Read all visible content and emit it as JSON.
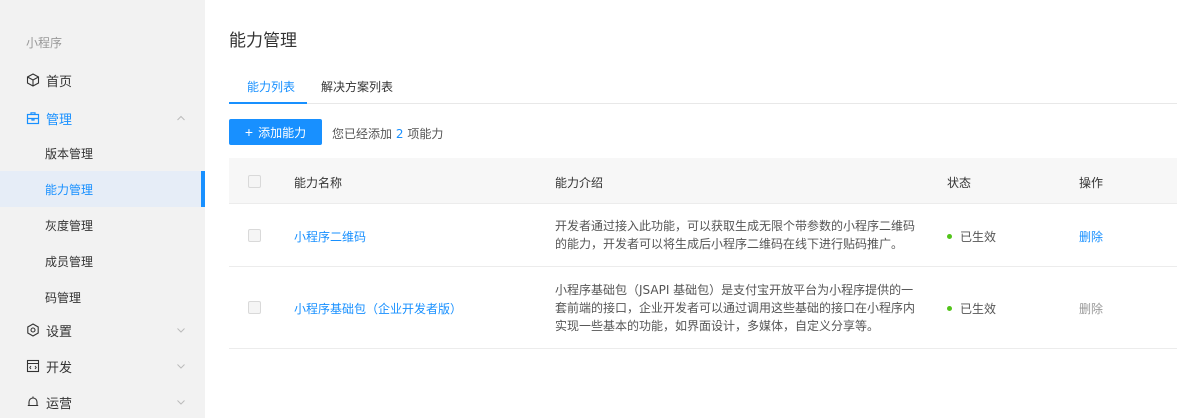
{
  "sidebar": {
    "section_title": "小程序",
    "items": [
      {
        "label": "首页"
      },
      {
        "label": "管理",
        "sub": [
          "版本管理",
          "能力管理",
          "灰度管理",
          "成员管理",
          "码管理"
        ]
      },
      {
        "label": "设置"
      },
      {
        "label": "开发"
      },
      {
        "label": "运营"
      }
    ]
  },
  "main": {
    "title": "能力管理",
    "tabs": [
      {
        "label": "能力列表"
      },
      {
        "label": "解决方案列表"
      }
    ],
    "add_button": "添加能力",
    "count_prefix": "您已经添加",
    "count_value": "2",
    "count_suffix": "项能力",
    "table": {
      "headers": [
        "能力名称",
        "能力介绍",
        "状态",
        "操作"
      ],
      "rows": [
        {
          "name": "小程序二维码",
          "desc_lines": [
            "开发者通过接入此功能，可以获取生成无限个带参数的小程序二维码",
            "的能力，开发者可以将生成后小程序二维码在线下进行贴码推广。"
          ],
          "status": "已生效",
          "action": "删除"
        },
        {
          "name": "小程序基础包（企业开发者版）",
          "desc_lines": [
            "小程序基础包（JSAPI 基础包）是支付宝开放平台为小程序提供的一",
            "套前端的接口，企业开发者可以通过调用这些基础的接口在小程序内",
            "实现一些基本的功能，如界面设计，多媒体，自定义分享等。"
          ],
          "status": "已生效",
          "action": "删除"
        }
      ]
    }
  },
  "colors": {
    "accent": "#1890ff",
    "status_green": "#52c41a"
  }
}
